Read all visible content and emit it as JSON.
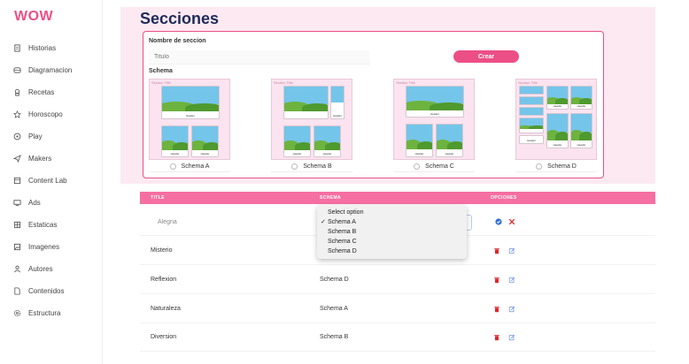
{
  "brand": "WOW",
  "sidebar": {
    "items": [
      {
        "label": "Historias",
        "icon": "document-icon"
      },
      {
        "label": "Diagramacion",
        "icon": "layout-icon"
      },
      {
        "label": "Recetas",
        "icon": "chef-icon"
      },
      {
        "label": "Horoscopo",
        "icon": "star-icon"
      },
      {
        "label": "Play",
        "icon": "play-icon"
      },
      {
        "label": "Makers",
        "icon": "send-icon"
      },
      {
        "label": "Content Lab",
        "icon": "box-icon"
      },
      {
        "label": "Ads",
        "icon": "monitor-icon"
      },
      {
        "label": "Estaticas",
        "icon": "grid-icon"
      },
      {
        "label": "Imagenes",
        "icon": "image-icon"
      },
      {
        "label": "Autores",
        "icon": "person-icon"
      },
      {
        "label": "Contenidos",
        "icon": "file-icon"
      },
      {
        "label": "Estructura",
        "icon": "settings-icon"
      }
    ]
  },
  "page": {
    "title": "Secciones"
  },
  "form": {
    "name_label": "Nombre de seccion",
    "title_placeholder": "Titulo",
    "create_label": "Crear",
    "schema_label": "Schema",
    "section_title_caption": "Section Title",
    "tile_caption": "Header",
    "schemas": [
      {
        "label": "Schema A"
      },
      {
        "label": "Schema B"
      },
      {
        "label": "Schema C"
      },
      {
        "label": "Schema D"
      }
    ]
  },
  "table": {
    "headers": {
      "title": "TITLE",
      "schema": "SCHEMA",
      "options": "OPCIONES"
    },
    "editing_row": {
      "title_value": "Alegria"
    },
    "rows": [
      {
        "title": "Misterio",
        "schema": ""
      },
      {
        "title": "Reflexion",
        "schema": "Schema D"
      },
      {
        "title": "Naturaleza",
        "schema": "Schema A"
      },
      {
        "title": "Diversion",
        "schema": "Schema B"
      }
    ]
  },
  "dropdown": {
    "options": [
      "Select option",
      "Schema A",
      "Schema B",
      "Schema C",
      "Schema D"
    ],
    "checked": "Schema A",
    "check_mark": "✓"
  },
  "colors": {
    "accent": "#ec4f86",
    "table_header": "#f56fa3",
    "band": "#fce9f1",
    "confirm": "#2f6fd6",
    "cancel": "#e0262b",
    "trash": "#e0262b",
    "edit": "#6b8fe0"
  }
}
